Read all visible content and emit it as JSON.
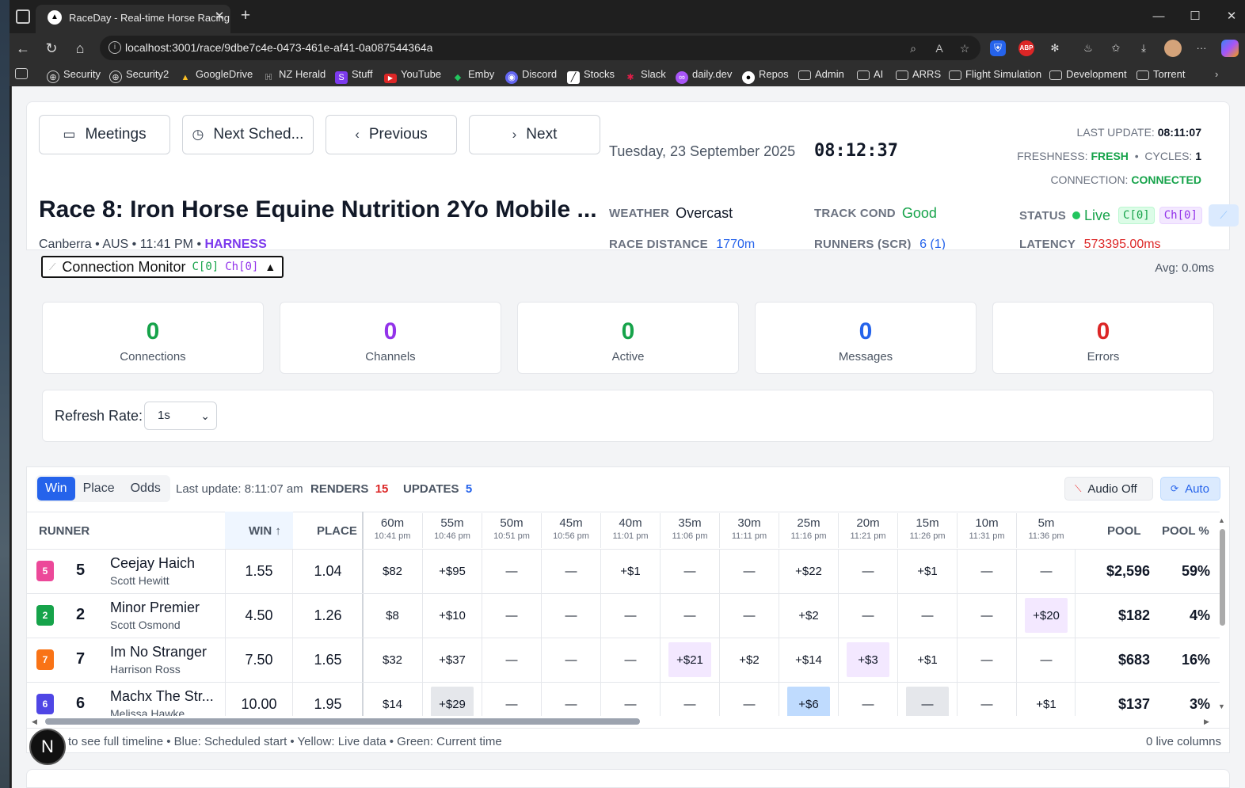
{
  "browser": {
    "tab_title": "RaceDay - Real-time Horse Racing",
    "url": "localhost:3001/race/9dbe7c4e-0473-461e-af41-0a087544364a",
    "bookmarks": [
      "Security",
      "Security2",
      "GoogleDrive",
      "NZ Herald",
      "Stuff",
      "YouTube",
      "Emby",
      "Discord",
      "Stocks",
      "Slack",
      "daily.dev",
      "Repos",
      "Admin",
      "AI",
      "ARRS",
      "Flight Simulation",
      "Development",
      "Torrent"
    ]
  },
  "header": {
    "nav": {
      "meetings": "Meetings",
      "next_sched": "Next Sched...",
      "previous": "Previous",
      "next": "Next"
    },
    "date": "Tuesday, 23 September 2025",
    "clock": "08:12:37",
    "last_update_label": "LAST UPDATE:",
    "last_update": "08:11:07",
    "freshness_label": "FRESHNESS:",
    "freshness": "FRESH",
    "cycles_label": "CYCLES:",
    "cycles": "1",
    "connection_label": "CONNECTION:",
    "connection": "CONNECTED",
    "race_title": "Race 8: Iron Horse Equine Nutrition 2Yo Mobile ...",
    "venue": "Canberra • AUS • 11:41 PM •",
    "race_type": "HARNESS",
    "weather_label": "WEATHER",
    "weather": "Overcast",
    "track_label": "TRACK COND",
    "track": "Good",
    "status_label": "STATUS",
    "status": "Live",
    "c_tag": "C[0]",
    "ch_tag": "Ch[0]",
    "distance_label": "RACE DISTANCE",
    "distance": "1770m",
    "runners_label": "RUNNERS (SCR)",
    "runners": "6 (1)",
    "latency_label": "LATENCY",
    "latency": "573395.00ms"
  },
  "monitor": {
    "title": "Connection Monitor",
    "c_tag": "C[0]",
    "ch_tag": "Ch[0]",
    "avg": "Avg: 0.0ms",
    "stats": [
      {
        "value": "0",
        "label": "Connections",
        "color": "#16a34a"
      },
      {
        "value": "0",
        "label": "Channels",
        "color": "#9333ea"
      },
      {
        "value": "0",
        "label": "Active",
        "color": "#16a34a"
      },
      {
        "value": "0",
        "label": "Messages",
        "color": "#2563eb"
      },
      {
        "value": "0",
        "label": "Errors",
        "color": "#dc2626"
      }
    ],
    "refresh_label": "Refresh Rate:",
    "refresh_value": "1s"
  },
  "grid": {
    "tabs": [
      "Win",
      "Place",
      "Odds"
    ],
    "last_update": "Last update: 8:11:07 am",
    "renders_label": "RENDERS",
    "renders": "15",
    "updates_label": "UPDATES",
    "updates": "5",
    "audio": "Audio Off",
    "auto": "Auto",
    "col_runner": "RUNNER",
    "col_win": "WIN ↑",
    "col_place": "PLACE",
    "col_pool": "POOL",
    "col_pool_pct": "POOL %",
    "timeline": [
      {
        "m": "60m",
        "t": "10:41 pm"
      },
      {
        "m": "55m",
        "t": "10:46 pm"
      },
      {
        "m": "50m",
        "t": "10:51 pm"
      },
      {
        "m": "45m",
        "t": "10:56 pm"
      },
      {
        "m": "40m",
        "t": "11:01 pm"
      },
      {
        "m": "35m",
        "t": "11:06 pm"
      },
      {
        "m": "30m",
        "t": "11:11 pm"
      },
      {
        "m": "25m",
        "t": "11:16 pm"
      },
      {
        "m": "20m",
        "t": "11:21 pm"
      },
      {
        "m": "15m",
        "t": "11:26 pm"
      },
      {
        "m": "10m",
        "t": "11:31 pm"
      },
      {
        "m": "5m",
        "t": "11:36 pm"
      }
    ],
    "rows": [
      {
        "no": "5",
        "badge_color": "#ec4899",
        "name": "Ceejay Haich",
        "driver": "Scott Hewitt",
        "win": "1.55",
        "place": "1.04",
        "cells": [
          "$82",
          "+$95",
          "—",
          "—",
          "+$1",
          "—",
          "—",
          "+$22",
          "—",
          "+$1",
          "—",
          "—"
        ],
        "hl": [
          0,
          0,
          0,
          0,
          0,
          0,
          0,
          0,
          0,
          0,
          0,
          0
        ],
        "pool": "$2,596",
        "pct": "59%"
      },
      {
        "no": "2",
        "badge_color": "#16a34a",
        "name": "Minor Premier",
        "driver": "Scott Osmond",
        "win": "4.50",
        "place": "1.26",
        "cells": [
          "$8",
          "+$10",
          "—",
          "—",
          "—",
          "—",
          "—",
          "+$2",
          "—",
          "—",
          "—",
          "+$20"
        ],
        "hl": [
          0,
          0,
          0,
          0,
          0,
          0,
          0,
          0,
          0,
          0,
          0,
          1
        ],
        "pool": "$182",
        "pct": "4%"
      },
      {
        "no": "7",
        "badge_color": "#f97316",
        "name": "Im No Stranger",
        "driver": "Harrison Ross",
        "win": "7.50",
        "place": "1.65",
        "cells": [
          "$32",
          "+$37",
          "—",
          "—",
          "—",
          "+$21",
          "+$2",
          "+$14",
          "+$3",
          "+$1",
          "—",
          "—"
        ],
        "hl": [
          0,
          0,
          0,
          0,
          0,
          1,
          0,
          0,
          1,
          0,
          0,
          0
        ],
        "pool": "$683",
        "pct": "16%"
      },
      {
        "no": "6",
        "badge_color": "#4f46e5",
        "name": "Machx The Str...",
        "driver": "Melissa Hawke",
        "win": "10.00",
        "place": "1.95",
        "cells": [
          "$14",
          "+$29",
          "—",
          "—",
          "—",
          "—",
          "—",
          "+$6",
          "—",
          "—",
          "—",
          "+$1"
        ],
        "hl": [
          0,
          2,
          0,
          0,
          0,
          0,
          0,
          3,
          0,
          2,
          0,
          0
        ],
        "pool": "$137",
        "pct": "3%"
      }
    ],
    "footer_text": "to see full timeline • Blue: Scheduled start • Yellow: Live data • Green: Current time",
    "live_columns": "0 live columns"
  },
  "colors": {
    "accent": "#2563eb",
    "purple_hl": "#f3e8ff",
    "blue_hl": "#bfdbfe",
    "gray_hl": "#e5e7eb"
  },
  "fab": "N"
}
